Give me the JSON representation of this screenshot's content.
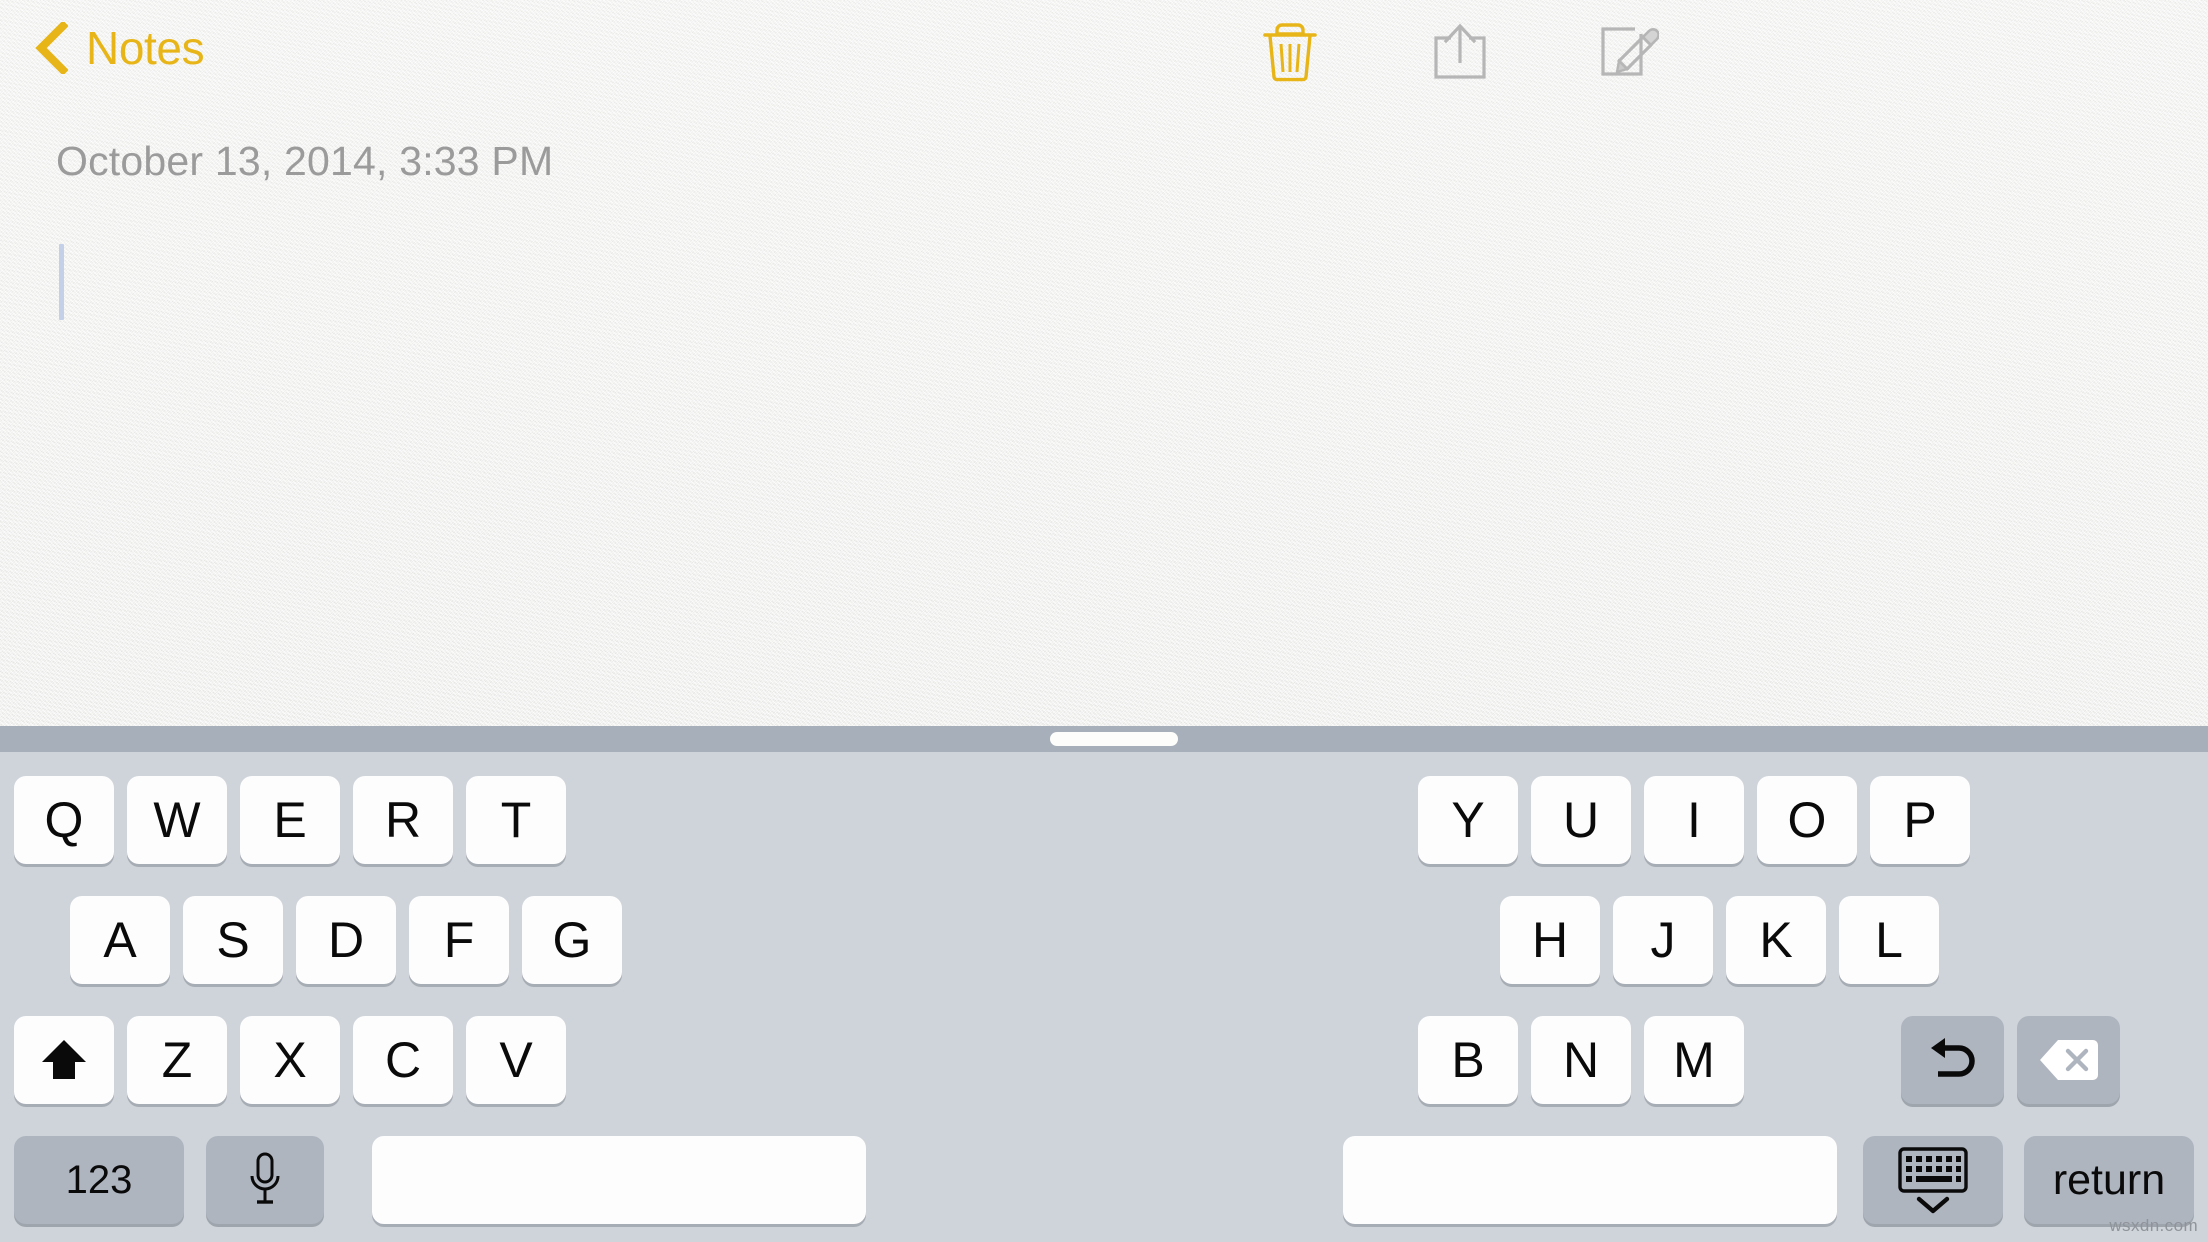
{
  "app": {
    "name": "Notes",
    "accent_color": "#e8b519",
    "paper_color": "#f3f3f1",
    "keyboard_bg": "#cfd4da",
    "keyboard_handle_bar": "#a7b0ba",
    "key_face": "#fdfdfd",
    "key_gray": "#aeb5bf",
    "caret_color": "#c3d0e8"
  },
  "topbar": {
    "back_label": "Notes",
    "back_icon": "chevron-left-icon",
    "actions": [
      {
        "name": "delete-note-button",
        "icon": "trash-icon",
        "color": "#e8b519"
      },
      {
        "name": "share-note-button",
        "icon": "share-icon",
        "color": "#b4b4b4"
      },
      {
        "name": "compose-note-button",
        "icon": "compose-icon",
        "color": "#b4b4b4"
      }
    ]
  },
  "note": {
    "timestamp": "October 13, 2014, 3:33 PM",
    "body": "",
    "caret_visible": true
  },
  "keyboard": {
    "type": "split",
    "grabber_icon": "keyboard-grabber-handle",
    "rows": {
      "row1_left": [
        "Q",
        "W",
        "E",
        "R",
        "T"
      ],
      "row1_right": [
        "Y",
        "U",
        "I",
        "O",
        "P"
      ],
      "row2_left": [
        "A",
        "S",
        "D",
        "F",
        "G"
      ],
      "row2_right": [
        "H",
        "J",
        "K",
        "L"
      ],
      "row3_left": [
        "Z",
        "X",
        "C",
        "V"
      ],
      "row3_right": [
        "B",
        "N",
        "M"
      ]
    },
    "special": {
      "shift": {
        "label": "",
        "icon": "shift-arrow-icon"
      },
      "undo": {
        "label": "",
        "icon": "undo-arrow-icon"
      },
      "backspace": {
        "label": "",
        "icon": "backspace-icon"
      },
      "numbers": {
        "label": "123",
        "icon": "numbers-key"
      },
      "dictation": {
        "label": "",
        "icon": "microphone-icon"
      },
      "space_left": {
        "label": "",
        "icon": "space-bar-left"
      },
      "space_right": {
        "label": "",
        "icon": "space-bar-right"
      },
      "hide_keyboard": {
        "label": "",
        "icon": "hide-keyboard-icon"
      },
      "return": {
        "label": "return",
        "icon": "return-key"
      }
    }
  },
  "watermark": {
    "text": "wsxdn.com"
  }
}
